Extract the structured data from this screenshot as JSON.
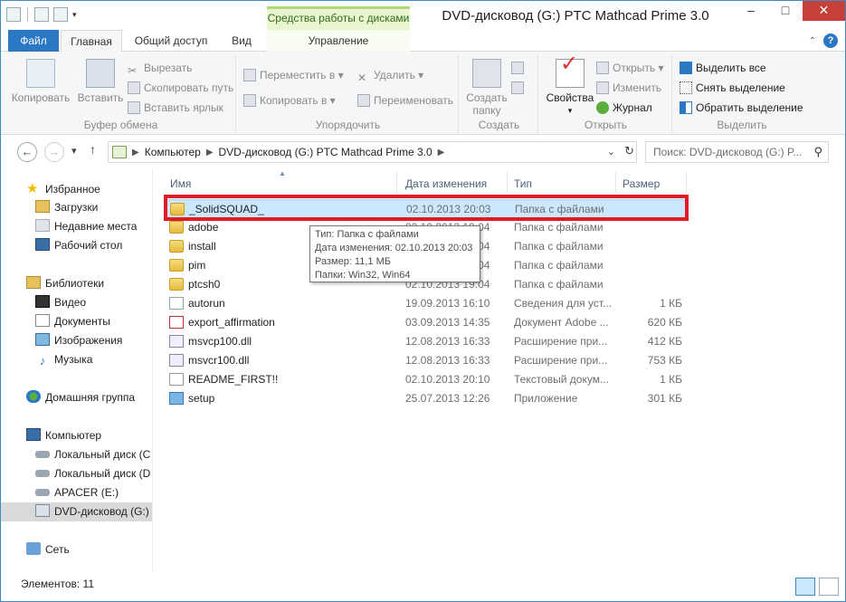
{
  "window": {
    "title": "DVD-дисковод (G:) PTC Mathcad Prime 3.0",
    "context_tab_header": "Средства работы с дисками"
  },
  "tabs": {
    "file": "Файл",
    "home": "Главная",
    "share": "Общий доступ",
    "view": "Вид",
    "manage": "Управление"
  },
  "ribbon": {
    "clipboard": {
      "label": "Буфер обмена",
      "copy": "Копировать",
      "paste": "Вставить",
      "cut": "Вырезать",
      "copy_path": "Скопировать путь",
      "paste_shortcut": "Вставить ярлык"
    },
    "organize": {
      "label": "Упорядочить",
      "move_to": "Переместить в",
      "copy_to": "Копировать в",
      "delete": "Удалить",
      "rename": "Переименовать"
    },
    "new": {
      "label": "Создать",
      "new_folder_line1": "Создать",
      "new_folder_line2": "папку"
    },
    "open": {
      "label": "Открыть",
      "properties": "Свойства",
      "open": "Открыть",
      "edit": "Изменить",
      "history": "Журнал"
    },
    "select": {
      "label": "Выделить",
      "select_all": "Выделить все",
      "select_none": "Снять выделение",
      "invert": "Обратить выделение"
    }
  },
  "address": {
    "crumbs": [
      "Компьютер",
      "DVD-дисковод (G:) PTC Mathcad Prime 3.0"
    ],
    "search_placeholder": "Поиск: DVD-дисковод (G:) P..."
  },
  "nav": {
    "favorites": "Избранное",
    "downloads": "Загрузки",
    "recent": "Недавние места",
    "desktop": "Рабочий стол",
    "libraries": "Библиотеки",
    "video": "Видео",
    "documents": "Документы",
    "images": "Изображения",
    "music": "Музыка",
    "homegroup": "Домашняя группа",
    "computer": "Компьютер",
    "local_c": "Локальный диск (C",
    "local_d": "Локальный диск (D",
    "apacer": "APACER (E:)",
    "dvd": "DVD-дисковод (G:) I",
    "network": "Сеть"
  },
  "columns": {
    "name": "Имя",
    "date": "Дата изменения",
    "type": "Тип",
    "size": "Размер"
  },
  "files": [
    {
      "name": "_SolidSQUAD_",
      "date": "02.10.2013 20:03",
      "type": "Папка с файлами",
      "size": "",
      "icon": "folder"
    },
    {
      "name": "adobe",
      "date": "02.10.2013 19:04",
      "type": "Папка с файлами",
      "size": "",
      "icon": "folder"
    },
    {
      "name": "install",
      "date": "02.10.2013 19:04",
      "type": "Папка с файлами",
      "size": "",
      "icon": "folder"
    },
    {
      "name": "pim",
      "date": "02.10.2013 19:04",
      "type": "Папка с файлами",
      "size": "",
      "icon": "folder"
    },
    {
      "name": "ptcsh0",
      "date": "02.10.2013 19:04",
      "type": "Папка с файлами",
      "size": "",
      "icon": "folder"
    },
    {
      "name": "autorun",
      "date": "19.09.2013 16:10",
      "type": "Сведения для уст...",
      "size": "1 КБ",
      "icon": "inf"
    },
    {
      "name": "export_affirmation",
      "date": "03.09.2013 14:35",
      "type": "Документ Adobe ...",
      "size": "620 КБ",
      "icon": "pdf"
    },
    {
      "name": "msvcp100.dll",
      "date": "12.08.2013 16:33",
      "type": "Расширение при...",
      "size": "412 КБ",
      "icon": "dll"
    },
    {
      "name": "msvcr100.dll",
      "date": "12.08.2013 16:33",
      "type": "Расширение при...",
      "size": "753 КБ",
      "icon": "dll"
    },
    {
      "name": "README_FIRST!!",
      "date": "02.10.2013 20:10",
      "type": "Текстовый докум...",
      "size": "1 КБ",
      "icon": "txt"
    },
    {
      "name": "setup",
      "date": "25.07.2013 12:26",
      "type": "Приложение",
      "size": "301 КБ",
      "icon": "exe"
    }
  ],
  "tooltip": {
    "type": "Тип: Папка с файлами",
    "date": "Дата изменения: 02.10.2013 20:03",
    "size": "Размер: 11,1 МБ",
    "folders": "Папки: Win32, Win64"
  },
  "status": {
    "count": "Элементов: 11"
  },
  "colors": {
    "accent": "#2b78c5",
    "selection": "#cce8ff",
    "highlight_border": "#e01b24",
    "context_tab": "#b3d77b"
  }
}
